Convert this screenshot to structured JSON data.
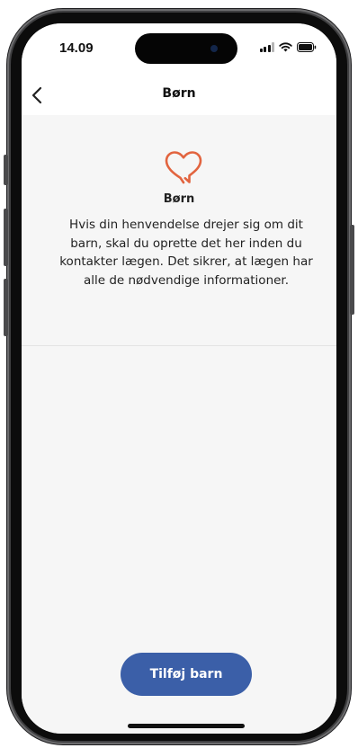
{
  "status_bar": {
    "time": "14.09",
    "icons": [
      "signal-icon",
      "wifi-icon",
      "battery-icon"
    ]
  },
  "nav": {
    "title": "Børn",
    "back_icon": "chevron-left-icon"
  },
  "content": {
    "icon": "heart-chat-icon",
    "icon_color": "#e2643f",
    "title": "Børn",
    "description": "Hvis din henvendelse drejer sig om dit barn, skal du oprette det her inden du kontakter lægen. Det sikrer, at lægen har alle de nødvendige informationer."
  },
  "actions": {
    "add_child_label": "Tilføj barn",
    "add_child_color": "#3b5fa8"
  }
}
